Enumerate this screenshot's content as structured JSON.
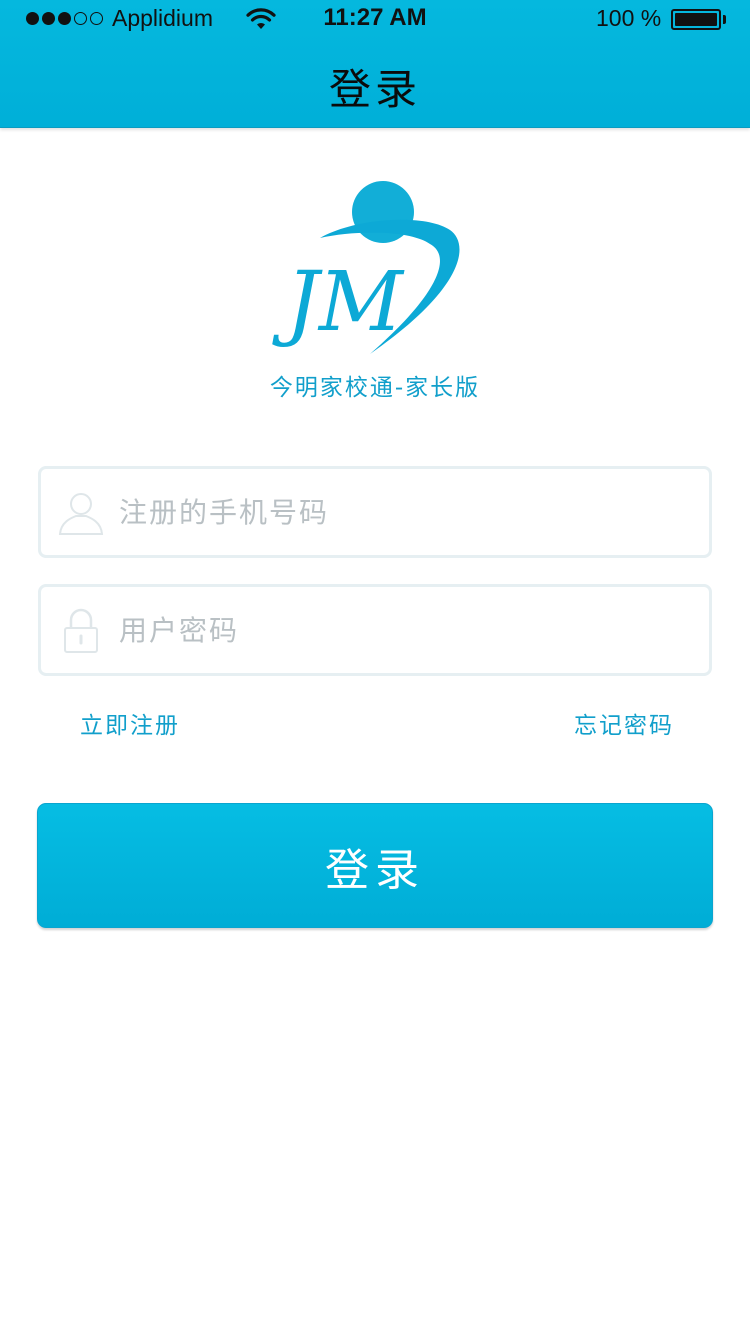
{
  "status_bar": {
    "carrier": "Applidium",
    "time": "11:27 AM",
    "battery": "100 %",
    "signal_strength": 3,
    "signal_max": 5,
    "icons": [
      "signal-dots",
      "wifi-icon",
      "battery-icon"
    ]
  },
  "nav": {
    "title": "登录"
  },
  "logo": {
    "mark_text": "JM",
    "app_name": "今明家校通-家长版"
  },
  "form": {
    "phone": {
      "placeholder": "注册的手机号码",
      "value": "",
      "icon": "user-icon"
    },
    "password": {
      "placeholder": "用户密码",
      "value": "",
      "icon": "lock-icon"
    },
    "register_link": "立即注册",
    "forgot_link": "忘记密码",
    "submit_label": "登录"
  },
  "colors": {
    "accent": "#00b1da",
    "link": "#119fcb",
    "placeholder": "#b9c0c4",
    "field_border": "#e6eff2",
    "background": "#ffffff"
  }
}
